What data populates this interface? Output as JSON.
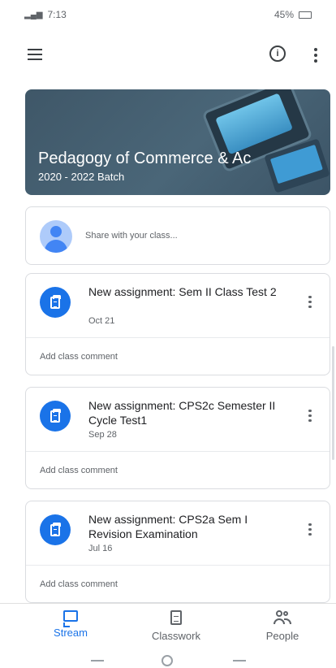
{
  "status_bar": {
    "time": "7:13",
    "battery": "45%",
    "signal_icon": "signal-icon",
    "battery_icon": "battery-icon"
  },
  "app_bar": {
    "menu_icon": "menu-icon",
    "info_icon": "info-icon",
    "more_icon": "more-vert-icon"
  },
  "banner": {
    "title": "Pedagogy of Commerce & Ac",
    "subtitle": "2020 - 2022 Batch",
    "background_color": "#455f71"
  },
  "share": {
    "placeholder": "Share with your class..."
  },
  "stream": {
    "posts": [
      {
        "title": "New assignment: Sem II Class Test 2",
        "date": "Oct 21",
        "comment_placeholder": "Add class comment"
      },
      {
        "title": "New assignment: CPS2c Semester II Cycle Test1",
        "date": "Sep 28",
        "comment_placeholder": "Add class comment"
      },
      {
        "title": "New assignment: CPS2a Sem I Revision Examination",
        "date": "Jul 16",
        "comment_placeholder": "Add class comment"
      }
    ]
  },
  "bottom_nav": {
    "items": [
      {
        "label": "Stream",
        "icon": "stream-icon",
        "active": true
      },
      {
        "label": "Classwork",
        "icon": "classwork-icon",
        "active": false
      },
      {
        "label": "People",
        "icon": "people-icon",
        "active": false
      }
    ],
    "accent_color": "#1a73e8"
  }
}
